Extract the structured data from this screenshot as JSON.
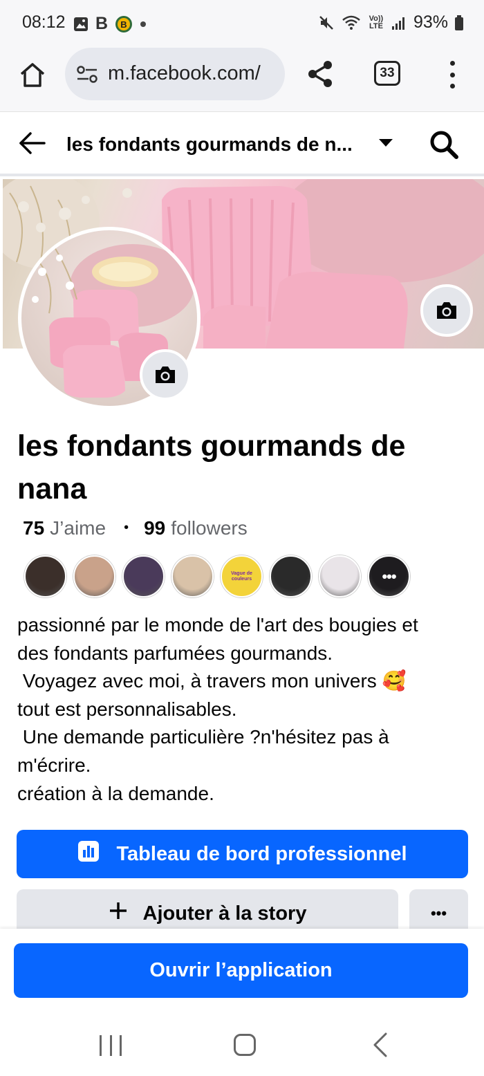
{
  "status_bar": {
    "time": "08:12",
    "battery": "93%",
    "left_icons": [
      "gallery-icon",
      "b-icon",
      "b-badge-icon",
      "dot-icon"
    ],
    "right_icons": [
      "mute-icon",
      "wifi-icon",
      "volte-icon",
      "signal-icon",
      "battery-icon"
    ],
    "volte_label": "Vo)) LTE"
  },
  "browser": {
    "url": "m.facebook.com/",
    "tab_count": "33"
  },
  "header": {
    "title": "les fondants gourmands de n..."
  },
  "profile": {
    "name": "les fondants gourmands de nana",
    "likes_count": "75",
    "likes_label": "J’aime",
    "followers_count": "99",
    "followers_label": "followers",
    "friends_more_label": "•••",
    "friend_colors": [
      "#3b2f2a",
      "#c9a28a",
      "#4a3a5a",
      "#d9c2a8",
      "#f3d33a",
      "#2a2a2a",
      "#e9e4e8",
      "#1e1c1f"
    ],
    "friend_badge_text": "Vague de couleurs",
    "bio_lines": [
      "passionné par le monde de l'art des bougies et",
      "des fondants parfumées gourmands.",
      " Voyagez avec moi, à travers mon univers 🥰",
      "tout est personnalisables.",
      " Une demande particulière ?n'hésitez pas à",
      "m'écrire.",
      "création à la demande."
    ]
  },
  "actions": {
    "dashboard_label": "Tableau de bord professionnel",
    "story_label": "Ajouter à la story",
    "more_label": "•••",
    "open_app_label": "Ouvrir l’application"
  },
  "colors": {
    "brand_blue": "#0866ff",
    "secondary_button": "#e4e6eb",
    "cover_pink": "#f6b3c8"
  }
}
